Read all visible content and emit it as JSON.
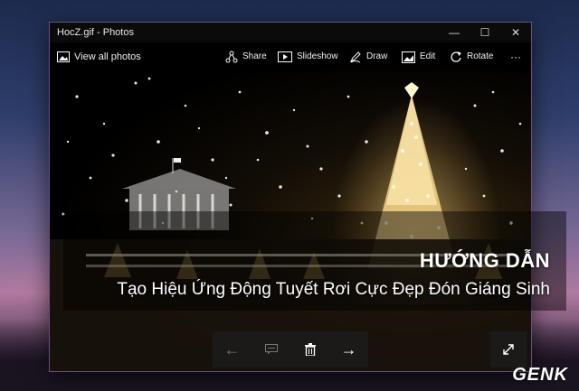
{
  "window": {
    "title": "HocZ.gif - Photos",
    "controls": {
      "minimize": "—",
      "maximize": "☐",
      "close": "✕"
    }
  },
  "toolbar": {
    "view_all": "View all photos",
    "share": "Share",
    "slideshow": "Slideshow",
    "draw": "Draw",
    "edit": "Edit",
    "rotate": "Rotate",
    "more": "···"
  },
  "overlay": {
    "headline": "HƯỚNG DẪN",
    "subline": "Tạo Hiệu Ứng Động Tuyết Rơi Cực Đẹp Đón Giáng Sinh"
  },
  "bottom_bar": {
    "previous": "←",
    "next": "→"
  },
  "watermark": {
    "logo": "GENK"
  },
  "colors": {
    "accent_border": "#6a5080",
    "tree_light": "#ffdc8c"
  }
}
